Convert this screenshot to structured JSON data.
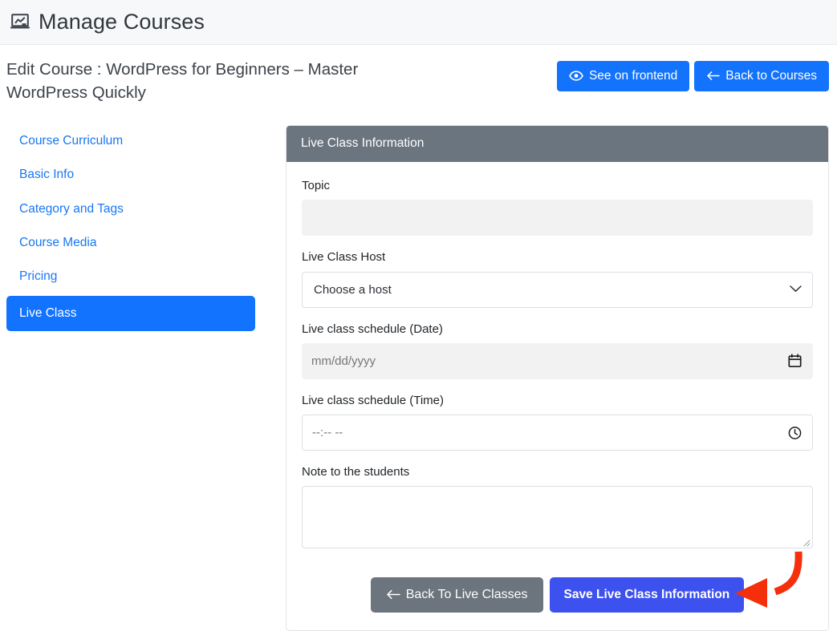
{
  "topbar": {
    "icon": "presentation-chart-icon",
    "title": "Manage Courses"
  },
  "course_header": {
    "title": "Edit Course : WordPress for Beginners – Master WordPress Quickly",
    "actions": [
      {
        "id": "see-on-frontend",
        "label": "See on frontend",
        "icon": "eye-icon"
      },
      {
        "id": "back-to-courses",
        "label": "Back to Courses",
        "icon": "arrow-left-icon"
      }
    ]
  },
  "sidebar": {
    "items": [
      {
        "label": "Course Curriculum",
        "active": false
      },
      {
        "label": "Basic Info",
        "active": false
      },
      {
        "label": "Category and Tags",
        "active": false
      },
      {
        "label": "Course Media",
        "active": false
      },
      {
        "label": "Pricing",
        "active": false
      },
      {
        "label": "Live Class",
        "active": true
      }
    ]
  },
  "card": {
    "header": "Live Class Information",
    "fields": {
      "topic": {
        "label": "Topic",
        "value": "",
        "placeholder": ""
      },
      "host": {
        "label": "Live Class Host",
        "value": "Choose a host",
        "caret": "chevron-down-icon"
      },
      "date": {
        "label": "Live class schedule (Date)",
        "placeholder": "mm/dd/yyyy",
        "icon": "calendar-icon"
      },
      "time": {
        "label": "Live class schedule (Time)",
        "placeholder": "--:-- --",
        "icon": "clock-icon"
      },
      "note": {
        "label": "Note to the students",
        "value": "",
        "placeholder": ""
      }
    },
    "footer": {
      "back_label": "Back To Live Classes",
      "back_icon": "arrow-left-icon",
      "save_label": "Save Live Class Information"
    }
  },
  "annotation": {
    "type": "curved-arrow",
    "color": "#f52e0c",
    "points_to": "Save Live Class Information"
  },
  "colors": {
    "primary_blue": "#1373fc",
    "active_nav_blue": "#1273ff",
    "link_blue": "#1877f2",
    "save_blue": "#3d51ef",
    "card_header_gray": "#6b757f",
    "secondary_gray": "#6c757d",
    "annotation_red": "#f52e0c"
  }
}
